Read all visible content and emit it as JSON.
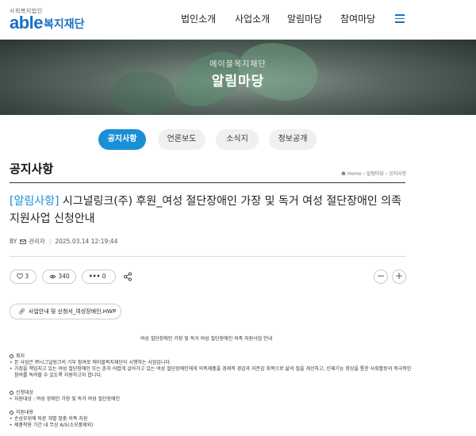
{
  "header": {
    "logo_small": "사회복지법인",
    "logo_able": "able",
    "logo_name": "복지재단",
    "nav": [
      "법인소개",
      "사업소개",
      "알림마당",
      "참여마당"
    ]
  },
  "hero": {
    "subtitle": "에이블복지재단",
    "title": "알림마당"
  },
  "tabs": [
    "공지사항",
    "언론보도",
    "소식지",
    "정보공개"
  ],
  "page": {
    "title": "공지사항",
    "breadcrumb": "Home › 알림마당 › 공지사항"
  },
  "post": {
    "category": "[알림사항]",
    "title": " 시그널링크(주) 후원_여성 절단장애인 가장 및 독거 여성 절단장애인 의족 지원사업 신청안내",
    "by_label": "BY",
    "author": "관리자",
    "date": "2025.03.14 12:19:44",
    "likes": "3",
    "views": "340",
    "comments": "0",
    "attachment": "사업안내 및 신청서_여성장애인.HWP"
  },
  "body": {
    "heading": "여성 절단장애인 가장 및 독거 여성 절단장애인 의족 지원사업 안내",
    "sections": [
      {
        "heading": "취지",
        "items": [
          "본 사업은 ㈜시그널링크의 기부 참여로 에이블복지재단이 시행하는 사업입니다.",
          "가정을 책임지고 있는 여성 절단장애인 또는 혼자 어렵게 살아가고 있는 여성 절단장애인에게 의족제품을 경제적 경감과 자존감 회복으로 삶의 질을 개선하고, 신체기능 향상을 통한 사회활동의 적극적인 참여를 독려할 수 있도록 지원하고자 합니다."
        ]
      },
      {
        "heading": "신청대상",
        "items": [
          "지원대상 : 여성 장애인 가장 및 독거 여성 절단장애인"
        ]
      },
      {
        "heading": "지원내용",
        "items": [
          "손상부위에 따른 개별 맞춤 의족 지원",
          "제품착용 기간 내 무상 A/S(소모품제외)"
        ]
      }
    ]
  },
  "colors": {
    "brand": "#1a6fc4",
    "accent": "#1a8fd6"
  }
}
